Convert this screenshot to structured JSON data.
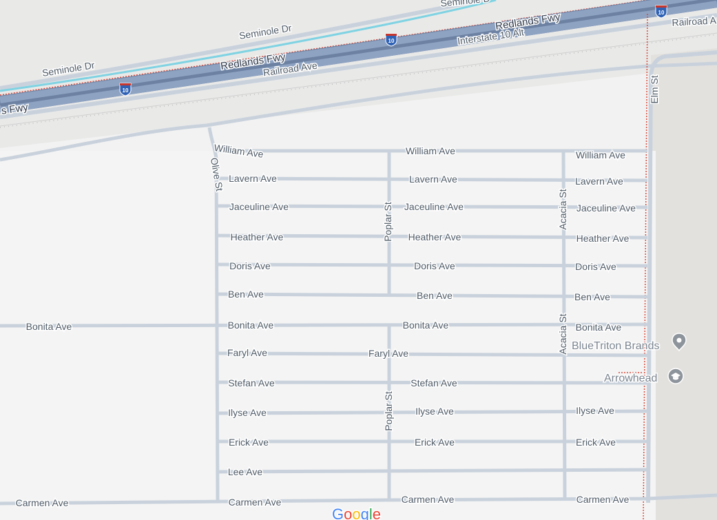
{
  "map": {
    "colors": {
      "background": "#f3f2f2",
      "freeway": "#8ea3c2",
      "road": "#c9d2dc",
      "rail": "#bdbdbd",
      "boundary": "#d94a3a",
      "poi": "#8d949b",
      "label": "#4e5a66"
    },
    "highways": {
      "redlands_fwy": "Redlands Fwy",
      "redlands_fwy_partial": "s Fwy",
      "interstate_alt": "Interstate 10 Alt",
      "shield_number": "10"
    },
    "roads": {
      "seminole_dr": "Seminole Dr",
      "seminole_dr_partial": "Seminole D",
      "railroad_ave": "Railroad Ave",
      "railroad_ave_partial": "Railroad A",
      "elm_st": "Elm St",
      "olive_st": "Olive St",
      "poplar_st": "Poplar St",
      "acacia_st": "Acacia St"
    },
    "avenues": {
      "william": "William Ave",
      "lavern": "Lavern Ave",
      "jaceuline": "Jaceuline Ave",
      "heather": "Heather Ave",
      "doris": "Doris Ave",
      "ben": "Ben Ave",
      "bonita": "Bonita Ave",
      "faryl": "Faryl Ave",
      "stefan": "Stefan Ave",
      "ilyse": "Ilyse Ave",
      "erick": "Erick Ave",
      "lee": "Lee Ave",
      "carmen": "Carmen Ave"
    },
    "pois": {
      "bluetriton": {
        "name": "BlueTriton Brands",
        "icon": "map-pin-icon"
      },
      "arrowhead": {
        "name": "Arrowhead",
        "icon": "school-cap-icon"
      }
    },
    "attribution": {
      "logo_letters": [
        "G",
        "o",
        "o",
        "g",
        "l",
        "e"
      ],
      "logo_colors": [
        "#4285f4",
        "#ea4335",
        "#fbbc05",
        "#4285f4",
        "#34a853",
        "#ea4335"
      ]
    }
  }
}
